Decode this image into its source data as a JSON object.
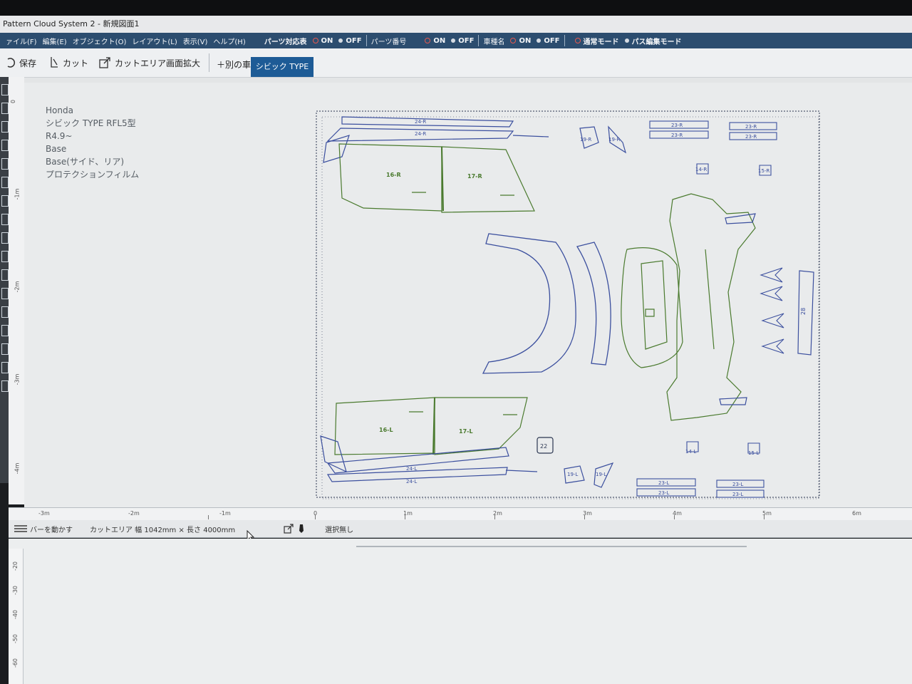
{
  "window": {
    "title": "Pattern Cloud System 2 - 新規図面1"
  },
  "menu": {
    "items": [
      "ァイル(F)",
      "編集(E)",
      "オブジェクト(O)",
      "レイアウト(L)",
      "表示(V)",
      "ヘルプ(H)"
    ],
    "parts_table": "パーツ対応表",
    "parts_number": "パーツ番号",
    "car_name": "車種名",
    "on_label": "ON",
    "off_label": "OFF",
    "normal_mode": "通常モード",
    "path_edit_mode": "パス編集モード"
  },
  "toolbar": {
    "save": "保存",
    "cut": "カット",
    "cut_area_zoom": "カットエリア画面拡大",
    "add_vehicle": "＋別の車種追加",
    "active_tab": "シビック TYPE"
  },
  "info": {
    "lines": [
      "Honda",
      "シビック TYPE RFL5型",
      "R4.9~",
      "Base",
      "Base(サイド、リア)",
      "プロテクションフィルム"
    ]
  },
  "parts": {
    "r16": "16-R",
    "r17": "17-R",
    "r24a": "24-R",
    "r24b": "24-R",
    "r23a": "23-R",
    "r23b": "23-R",
    "r23c": "23-R",
    "r23d": "23-R",
    "r19a": "19-R",
    "r19b": "19-R",
    "r14a": "14-R",
    "r15a": "15-R",
    "p28": "28",
    "p22": "22",
    "l16": "16-L",
    "l17": "17-L",
    "l24a": "24-L",
    "l24b": "24-L",
    "l19a": "19-L",
    "l19b": "19-L",
    "l14": "14-L",
    "l15": "15-L",
    "l23a": "23-L",
    "l23b": "23-L",
    "l23c": "23-L",
    "l23d": "23-L"
  },
  "rulers": {
    "h_labels": [
      "-3m",
      "-2m",
      "-1m",
      "0",
      "1m",
      "2m",
      "3m",
      "4m",
      "5m",
      "6m"
    ],
    "v_labels": [
      "0",
      "-1m",
      "-2m",
      "-3m",
      "-4m"
    ],
    "lower_labels": [
      "-20",
      "-30",
      "-40",
      "-50",
      "-60"
    ]
  },
  "status": {
    "move_bar": "バーを動かす",
    "cut_area": "カットエリア 幅 1042mm × 長さ 4000mm",
    "selection": "選択無し"
  },
  "colors": {
    "menu_bg": "#2c4d6f",
    "tab_active": "#1d5b96",
    "outline_green": "#4a7a2e",
    "outline_blue": "#3b4f9e"
  }
}
